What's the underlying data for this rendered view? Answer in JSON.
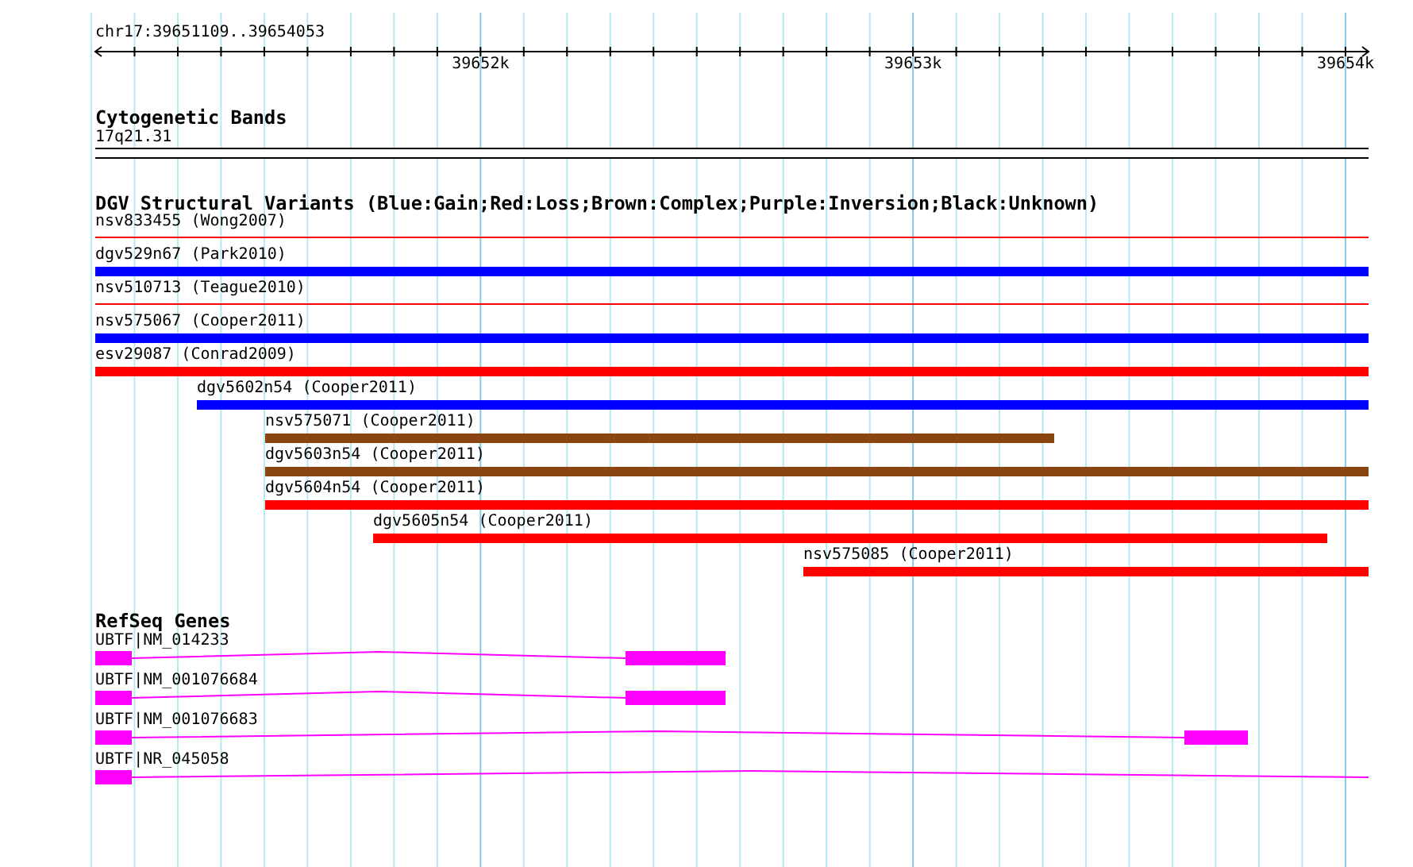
{
  "ruler": {
    "location": "chr17:39651109..39654053",
    "tick_labels": [
      "39652k",
      "39653k",
      "39654k"
    ]
  },
  "tracks": [
    {
      "kind": "cytoband",
      "title": "Cytogenetic Bands",
      "bands": [
        {
          "label": "17q21.31"
        }
      ]
    },
    {
      "kind": "variants",
      "title": "DGV Structural Variants (Blue:Gain;Red:Loss;Brown:Complex;Purple:Inversion;Black:Unknown)",
      "features": [
        {
          "label": "nsv833455 (Wong2007)",
          "kind": "line",
          "color": "#ff0000"
        },
        {
          "label": "dgv529n67 (Park2010)",
          "kind": "bar",
          "color": "#0000ff"
        },
        {
          "label": "nsv510713 (Teague2010)",
          "kind": "line",
          "color": "#ff0000"
        },
        {
          "label": "nsv575067 (Cooper2011)",
          "kind": "bar",
          "color": "#0000ff"
        },
        {
          "label": "esv29087 (Conrad2009)",
          "kind": "bar",
          "color": "#ff0000"
        },
        {
          "label": "dgv5602n54 (Cooper2011)",
          "kind": "bar",
          "color": "#0000ff"
        },
        {
          "label": "nsv575071 (Cooper2011)",
          "kind": "bar",
          "color": "#8b4513"
        },
        {
          "label": "dgv5603n54 (Cooper2011)",
          "kind": "bar",
          "color": "#8b4513"
        },
        {
          "label": "dgv5604n54 (Cooper2011)",
          "kind": "bar",
          "color": "#ff0000"
        },
        {
          "label": "dgv5605n54 (Cooper2011)",
          "kind": "bar",
          "color": "#ff0000"
        },
        {
          "label": "nsv575085 (Cooper2011)",
          "kind": "bar",
          "color": "#ff0000"
        }
      ]
    },
    {
      "kind": "genes",
      "title": "RefSeq Genes",
      "transcripts": [
        {
          "label": "UBTF|NM_014233"
        },
        {
          "label": "UBTF|NM_001076684"
        },
        {
          "label": "UBTF|NM_001076683"
        },
        {
          "label": "UBTF|NR_045058"
        }
      ]
    }
  ]
}
